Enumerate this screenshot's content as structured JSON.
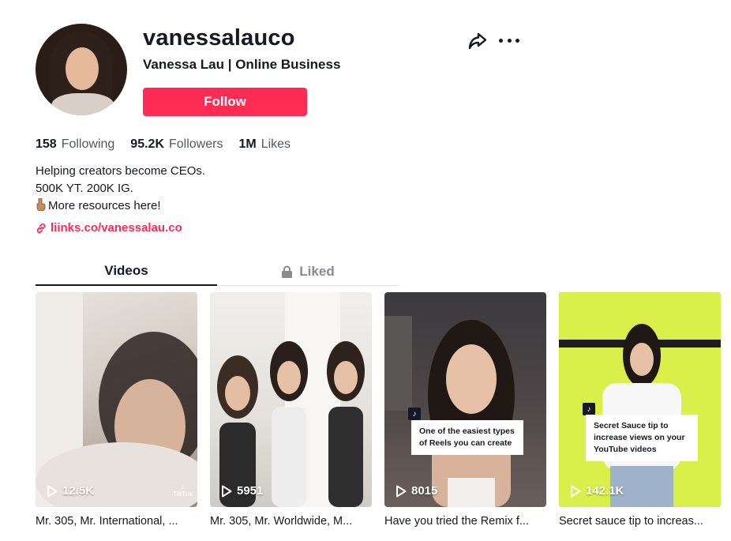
{
  "profile": {
    "username": "vanessalauco",
    "nickname": "Vanessa Lau | Online Business",
    "follow_label": "Follow"
  },
  "stats": [
    {
      "value": "158",
      "label": "Following"
    },
    {
      "value": "95.2K",
      "label": "Followers"
    },
    {
      "value": "1M",
      "label": "Likes"
    }
  ],
  "bio": {
    "line1": "Helping creators become CEOs.",
    "line2": "500K YT. 200K IG.",
    "line3": "More resources here!",
    "link": "liinks.co/vanessalau.co"
  },
  "tabs": {
    "videos": "Videos",
    "liked": "Liked"
  },
  "videos": [
    {
      "views": "12.5K",
      "caption": "Mr. 305, Mr. International, ...",
      "watermark": "TikTok"
    },
    {
      "views": "5951",
      "caption": "Mr. 305, Mr. Worldwide, M..."
    },
    {
      "views": "8015",
      "caption": "Have you tried the Remix f...",
      "overlay": "One of the easiest types of Reels you can create"
    },
    {
      "views": "142.1K",
      "caption": "Secret sauce tip to increas...",
      "overlay": "Secret Sauce tip to increase views on your YouTube videos"
    }
  ],
  "colors": {
    "brand": "#fe2c55",
    "text": "#161823",
    "muted": "#555760",
    "thumb4_bg": "#d9f04a"
  }
}
